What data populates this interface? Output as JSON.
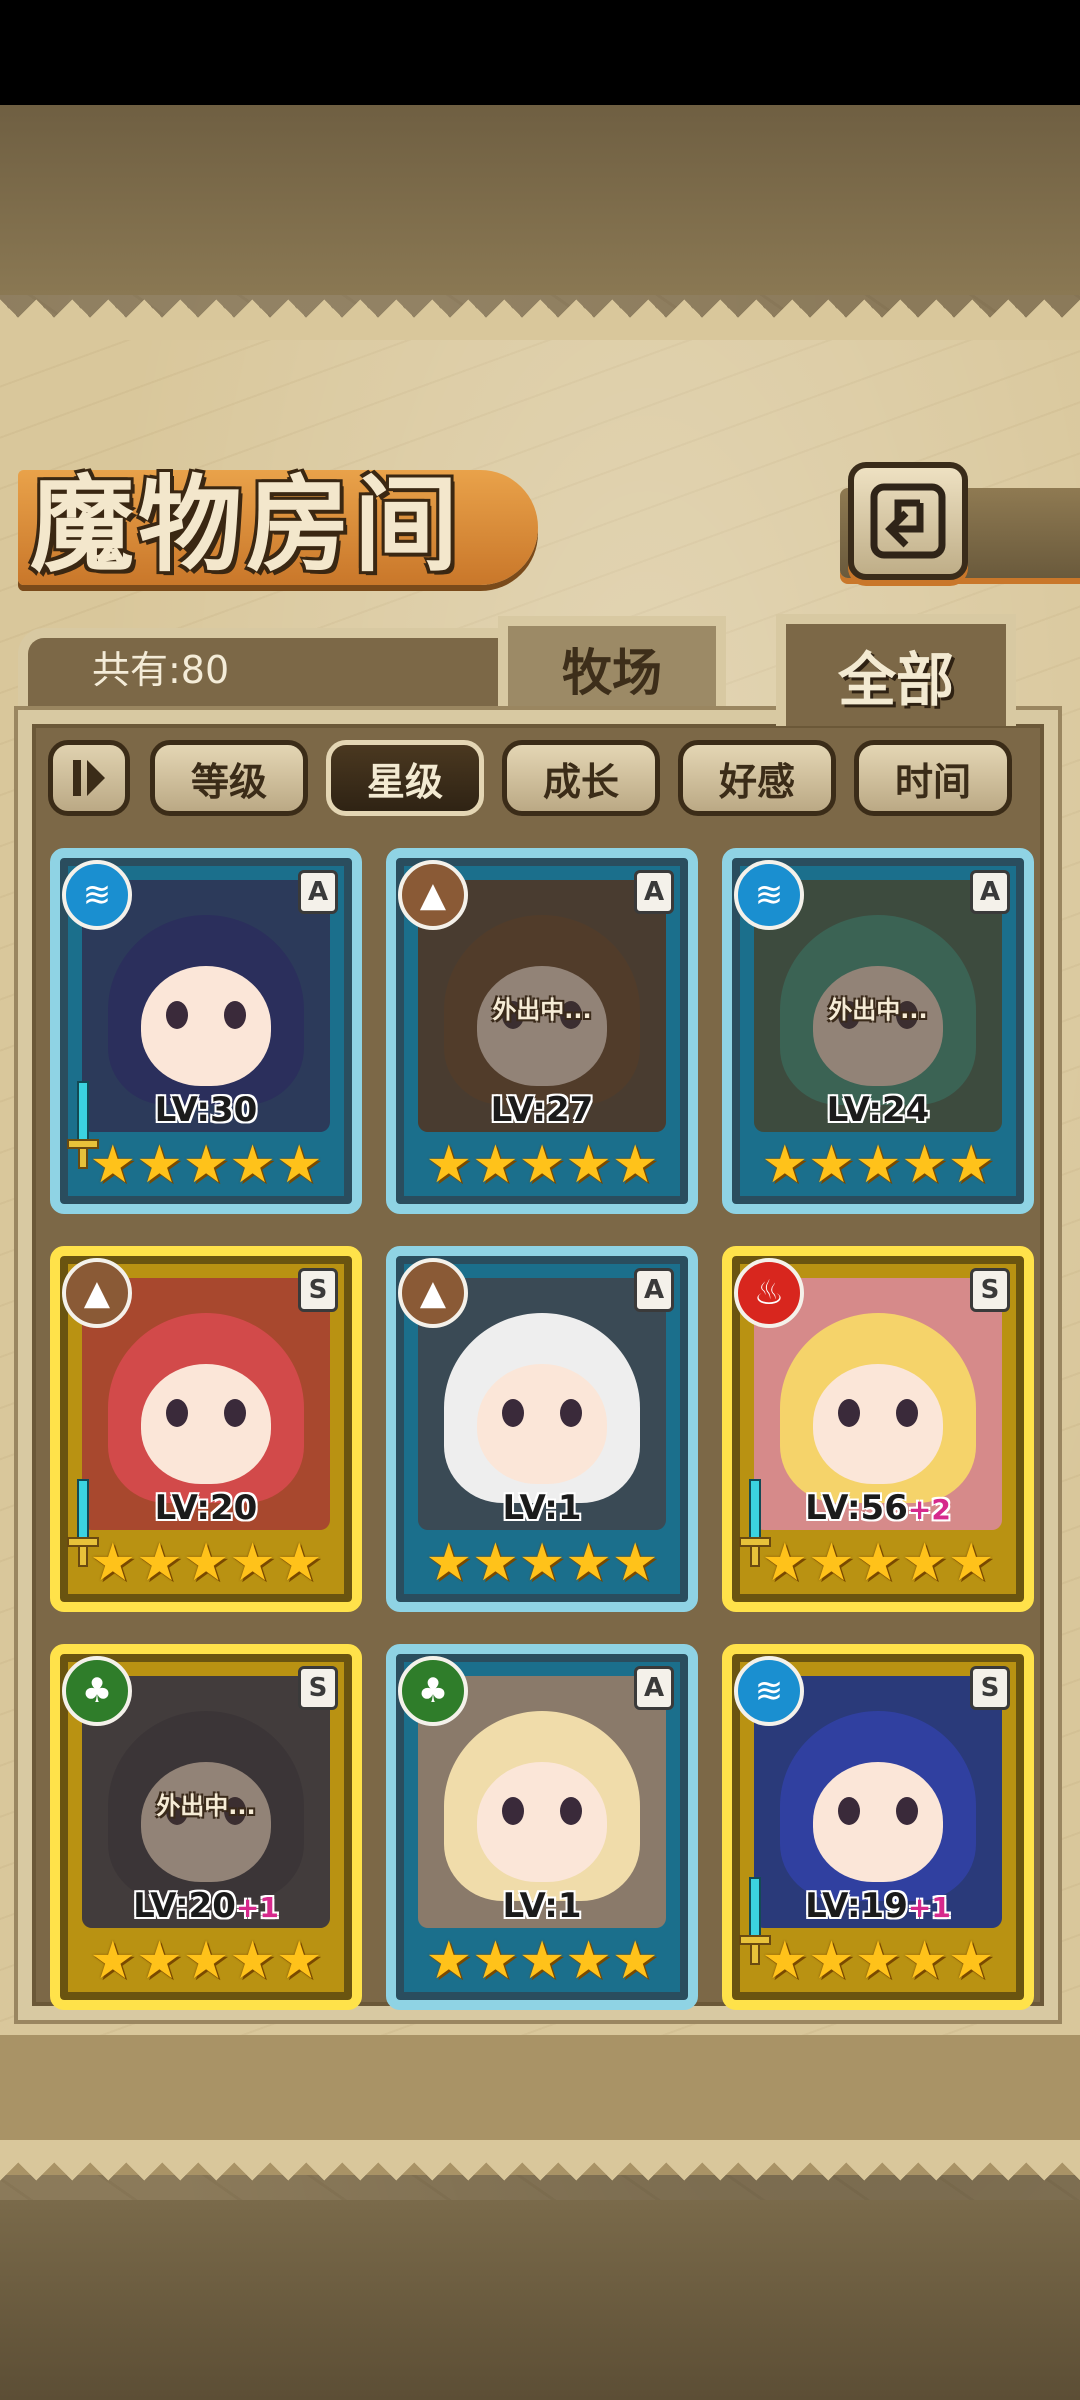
{
  "header": {
    "title": "魔物房间"
  },
  "count": {
    "text": "共有:80"
  },
  "tabs": [
    {
      "label": "牧场",
      "active": false
    },
    {
      "label": "全部",
      "active": true
    }
  ],
  "sort": {
    "buttons": [
      {
        "label": "等级",
        "active": false
      },
      {
        "label": "星级",
        "active": true
      },
      {
        "label": "成长",
        "active": false
      },
      {
        "label": "好感",
        "active": false
      },
      {
        "label": "时间",
        "active": false
      }
    ]
  },
  "monsters": [
    {
      "element": "water-icon",
      "rank": "A",
      "level": "LV:30",
      "bonus": "",
      "stars": "★★★★★",
      "status": "",
      "frame": "blue",
      "weapon": true
    },
    {
      "element": "earth-icon",
      "rank": "A",
      "level": "LV:27",
      "bonus": "",
      "stars": "★★★★★",
      "status": "外出中...",
      "frame": "blue",
      "weapon": false
    },
    {
      "element": "water-icon",
      "rank": "A",
      "level": "LV:24",
      "bonus": "",
      "stars": "★★★★★",
      "status": "外出中...",
      "frame": "blue",
      "weapon": false
    },
    {
      "element": "earth-icon",
      "rank": "S",
      "level": "LV:20",
      "bonus": "",
      "stars": "★★★★★",
      "status": "",
      "frame": "gold",
      "weapon": true
    },
    {
      "element": "earth-icon",
      "rank": "A",
      "level": "LV:1",
      "bonus": "",
      "stars": "★★★★★",
      "status": "",
      "frame": "blue",
      "weapon": false
    },
    {
      "element": "fire-icon",
      "rank": "S",
      "level": "LV:56",
      "bonus": "+2",
      "stars": "★★★★★",
      "status": "",
      "frame": "gold",
      "weapon": true
    },
    {
      "element": "wood-icon",
      "rank": "S",
      "level": "LV:20",
      "bonus": "+1",
      "stars": "★★★★★",
      "status": "外出中...",
      "frame": "gold",
      "weapon": false
    },
    {
      "element": "wood-icon",
      "rank": "A",
      "level": "LV:1",
      "bonus": "",
      "stars": "★★★★★",
      "status": "",
      "frame": "blue",
      "weapon": false
    },
    {
      "element": "water-icon",
      "rank": "S",
      "level": "LV:19",
      "bonus": "+1",
      "stars": "★★★★★",
      "status": "",
      "frame": "gold",
      "weapon": true
    }
  ]
}
